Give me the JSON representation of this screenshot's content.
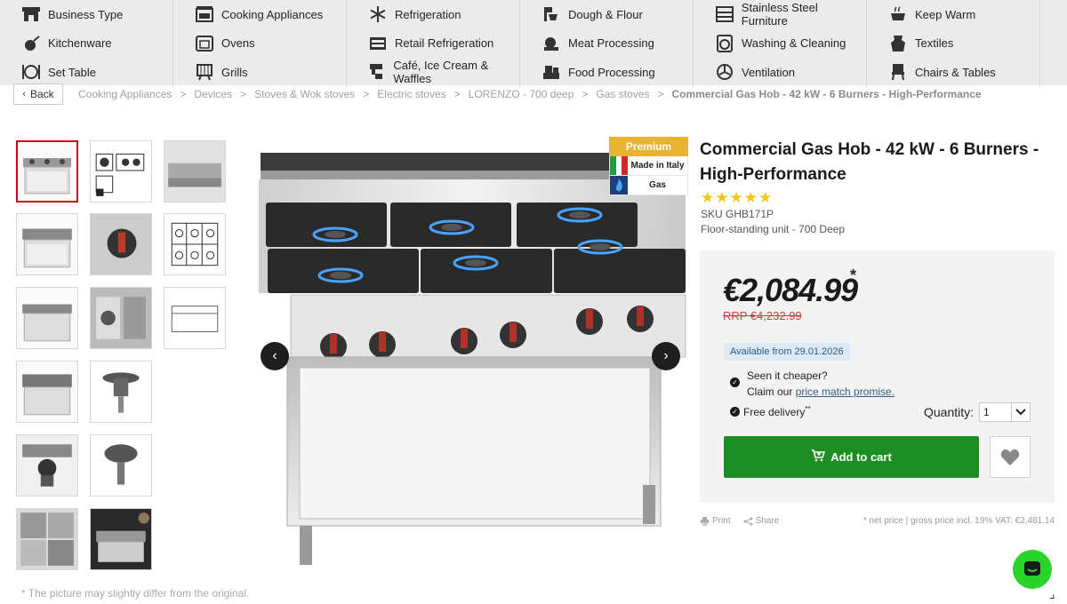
{
  "nav": {
    "categories": [
      {
        "label": "Business Type",
        "icon": "store-icon"
      },
      {
        "label": "Cooking Appliances",
        "icon": "stove-icon"
      },
      {
        "label": "Refrigeration",
        "icon": "snowflake-icon"
      },
      {
        "label": "Dough & Flour",
        "icon": "dough-mixer-icon"
      },
      {
        "label": "Stainless Steel Furniture",
        "icon": "steel-furniture-icon"
      },
      {
        "label": "Keep Warm",
        "icon": "keep-warm-icon"
      },
      {
        "label": "Kitchenware",
        "icon": "kitchenware-icon"
      },
      {
        "label": "Ovens",
        "icon": "oven-icon"
      },
      {
        "label": "Retail Refrigeration",
        "icon": "display-fridge-icon"
      },
      {
        "label": "Meat Processing",
        "icon": "meat-slicer-icon"
      },
      {
        "label": "Washing & Cleaning",
        "icon": "washing-machine-icon"
      },
      {
        "label": "Textiles",
        "icon": "apron-icon"
      },
      {
        "label": "Set Table",
        "icon": "plate-cutlery-icon"
      },
      {
        "label": "Grills",
        "icon": "grill-icon"
      },
      {
        "label": "Café, Ice Cream & Waffles",
        "icon": "coffee-machine-icon"
      },
      {
        "label": "Food Processing",
        "icon": "food-processor-icon"
      },
      {
        "label": "Ventilation",
        "icon": "fan-icon"
      },
      {
        "label": "Chairs & Tables",
        "icon": "chair-icon"
      }
    ]
  },
  "back_label": "Back",
  "breadcrumb": {
    "items": [
      "Cooking Appliances",
      "Devices",
      "Stoves & Wok stoves",
      "Electric stoves",
      "LORENZO - 700 deep",
      "Gas stoves"
    ],
    "current": "Commercial Gas Hob - 42 kW - 6 Burners - High-Performance",
    "separator": ">"
  },
  "badges": {
    "premium": "Premium",
    "origin": "Made in Italy",
    "fuel": "Gas"
  },
  "product": {
    "title": "Commercial Gas Hob - 42 kW - 6 Burners - High-Performance",
    "rating_stars": 5,
    "sku": "SKU GHB171P",
    "subtitle": "Floor-standing unit - 700 Deep"
  },
  "pricing": {
    "price": "€2,084.99",
    "asterisk": "*",
    "rrp": "RRP €4,232.99",
    "availability": "Available from 29.01.2026",
    "cheaper_line1": "Seen it cheaper?",
    "cheaper_line2_prefix": "Claim our ",
    "cheaper_link": "price match promise.",
    "delivery": "Free delivery",
    "delivery_sup": "**",
    "quantity_label": "Quantity:",
    "quantity_value": "1",
    "add_to_cart": "Add to cart"
  },
  "utility": {
    "print": "Print",
    "share": "Share",
    "net_price_note": "* net price | gross price incl. 19% VAT: €2,481.14"
  },
  "footnote": "* The picture may slightly differ from the original.",
  "colors": {
    "accent_green": "#1e8e24",
    "chat_green": "#2bd42b",
    "premium_gold": "#e9b233",
    "rrp_red": "#d23a3a",
    "star_yellow": "#f3c614"
  }
}
